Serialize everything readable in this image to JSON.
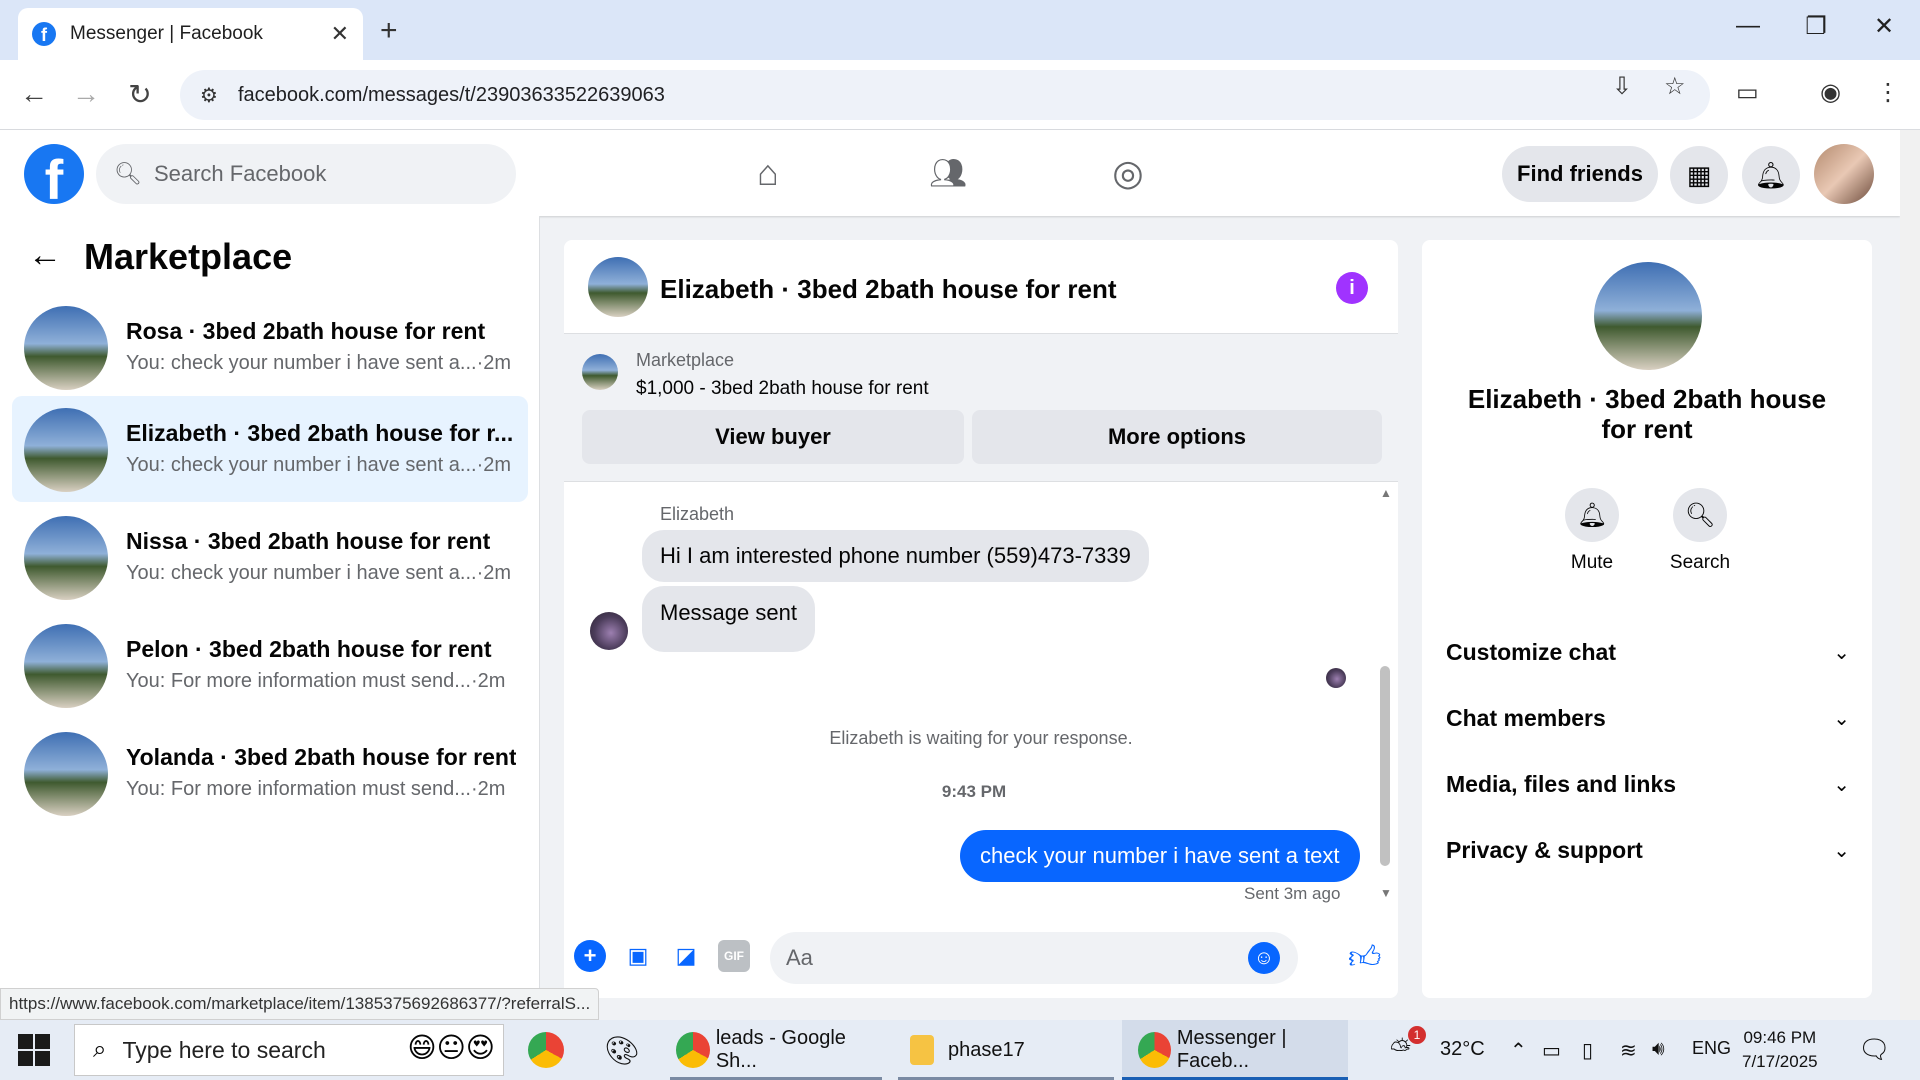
{
  "browser": {
    "tab_title": "Messenger | Facebook",
    "url": "facebook.com/messages/t/23903633522639063",
    "status_url": "https://www.facebook.com/marketplace/item/1385375692686377/?referralS..."
  },
  "header": {
    "search_placeholder": "Search Facebook",
    "find_friends": "Find friends"
  },
  "sidebar": {
    "title": "Marketplace",
    "conversations": [
      {
        "name": "Rosa · 3bed 2bath house for rent",
        "snippet": "You: check your number i have sent a...·2m",
        "active": false
      },
      {
        "name": "Elizabeth · 3bed 2bath house for r...",
        "snippet": "You: check your number i have sent a...·2m",
        "active": true
      },
      {
        "name": "Nissa · 3bed 2bath house for rent",
        "snippet": "You: check your number i have sent a...·2m",
        "active": false
      },
      {
        "name": "Pelon · 3bed 2bath house for rent",
        "snippet": "You: For more information must send...·2m",
        "active": false
      },
      {
        "name": "Yolanda · 3bed 2bath house for rent",
        "snippet": "You: For more information must send...·2m",
        "active": false
      }
    ]
  },
  "chat": {
    "title": "Elizabeth · 3bed 2bath house for rent",
    "listing_source": "Marketplace",
    "listing_price": "$1,000 - 3bed 2bath house for rent",
    "view_buyer": "View buyer",
    "more_options": "More options",
    "sender_name": "Elizabeth",
    "incoming_1": "Hi I am interested phone number (559)473-7339",
    "incoming_2": "Message sent",
    "waiting_notice": "Elizabeth is waiting for your response.",
    "timestamp": "9:43 PM",
    "outgoing_1": "check your number i have sent a text",
    "sent_status": "Sent 3m ago",
    "input_placeholder": "Aa"
  },
  "details": {
    "name": "Elizabeth · 3bed 2bath house for rent",
    "mute": "Mute",
    "search": "Search",
    "sections": [
      "Customize chat",
      "Chat members",
      "Media, files and links",
      "Privacy & support"
    ]
  },
  "taskbar": {
    "search_placeholder": "Type here to search",
    "apps": [
      "leads - Google Sh...",
      "phase17",
      "Messenger | Faceb..."
    ],
    "weather": "32°C",
    "weather_badge": "1",
    "language": "ENG",
    "time": "09:46 PM",
    "date": "7/17/2025"
  },
  "colors": {
    "facebook_blue": "#1877f2",
    "messenger_blue": "#0866ff",
    "active_conversation": "#e7f3ff",
    "info_purple": "#a033ff"
  }
}
